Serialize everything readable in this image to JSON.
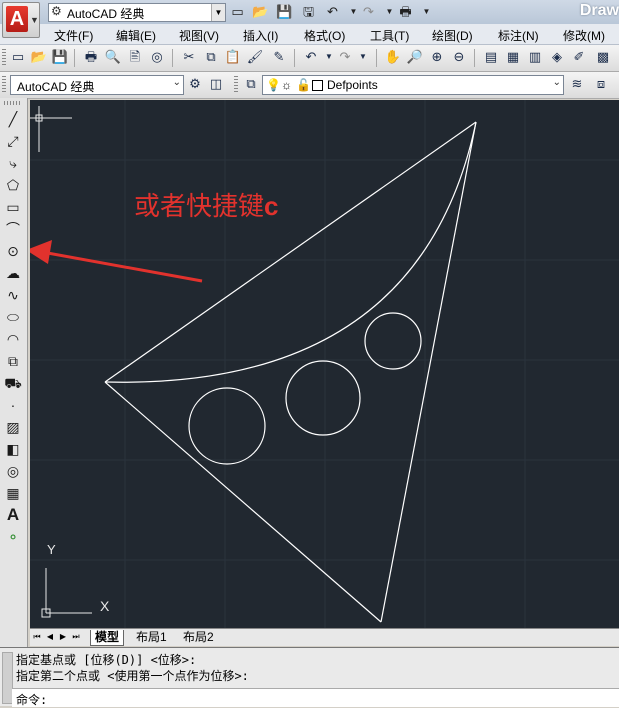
{
  "title_bar": {
    "app_button_letter": "A",
    "workspace": "AutoCAD 经典",
    "document_title": "Draw",
    "qat_icons": [
      "new-icon",
      "open-icon",
      "save-icon",
      "save-as-icon",
      "undo-icon",
      "redo-icon",
      "plot-icon"
    ]
  },
  "menu": {
    "items": [
      "文件(F)",
      "编辑(E)",
      "视图(V)",
      "插入(I)",
      "格式(O)",
      "工具(T)",
      "绘图(D)",
      "标注(N)",
      "修改(M)"
    ]
  },
  "standard_toolbar": {
    "icons": [
      "qnew-icon",
      "open-icon",
      "save-icon",
      "plot-icon",
      "plot-preview-icon",
      "publish-icon",
      "3d-print-icon",
      "cut-icon",
      "copy-icon",
      "paste-icon",
      "match-properties-icon",
      "undo-icon",
      "redo-icon",
      "pan-icon",
      "zoom-realtime-icon",
      "zoom-window-icon",
      "zoom-previous-icon",
      "properties-icon",
      "design-center-icon",
      "tool-palettes-icon",
      "sheet-set-icon",
      "markup-icon",
      "calculator-icon"
    ]
  },
  "workspace_toolbar": {
    "workspace_select": "AutoCAD 经典",
    "layer_name": "Defpoints",
    "layer_state_icons": [
      "lightbulb-icon",
      "sun-icon",
      "lock-icon",
      "color-square-icon"
    ]
  },
  "draw_toolbar": {
    "tools": [
      "line-icon",
      "construction-line-icon",
      "polyline-icon",
      "polygon-icon",
      "rectangle-icon",
      "arc-icon",
      "circle-icon",
      "revision-cloud-icon",
      "spline-icon",
      "ellipse-icon",
      "ellipse-arc-icon",
      "insert-block-icon",
      "make-block-icon",
      "point-icon",
      "hatch-icon",
      "gradient-icon",
      "region-icon",
      "table-icon",
      "multiline-text-icon",
      "add-selected-icon"
    ],
    "text_tool_label": "A"
  },
  "canvas": {
    "background_color": "#212830",
    "line_color": "#ffffff",
    "annotation_text": "或者快捷键",
    "annotation_key": "c",
    "annotation_color": "#e2322d",
    "ucs_x_label": "X",
    "ucs_y_label": "Y"
  },
  "layout_tabs": {
    "tabs": [
      "模型",
      "布局1",
      "布局2"
    ],
    "active": "模型"
  },
  "command_line": {
    "history": [
      "指定基点或 [位移(D)] <位移>:",
      "指定第二个点或 <使用第一个点作为位移>:"
    ],
    "prompt": "命令:"
  }
}
